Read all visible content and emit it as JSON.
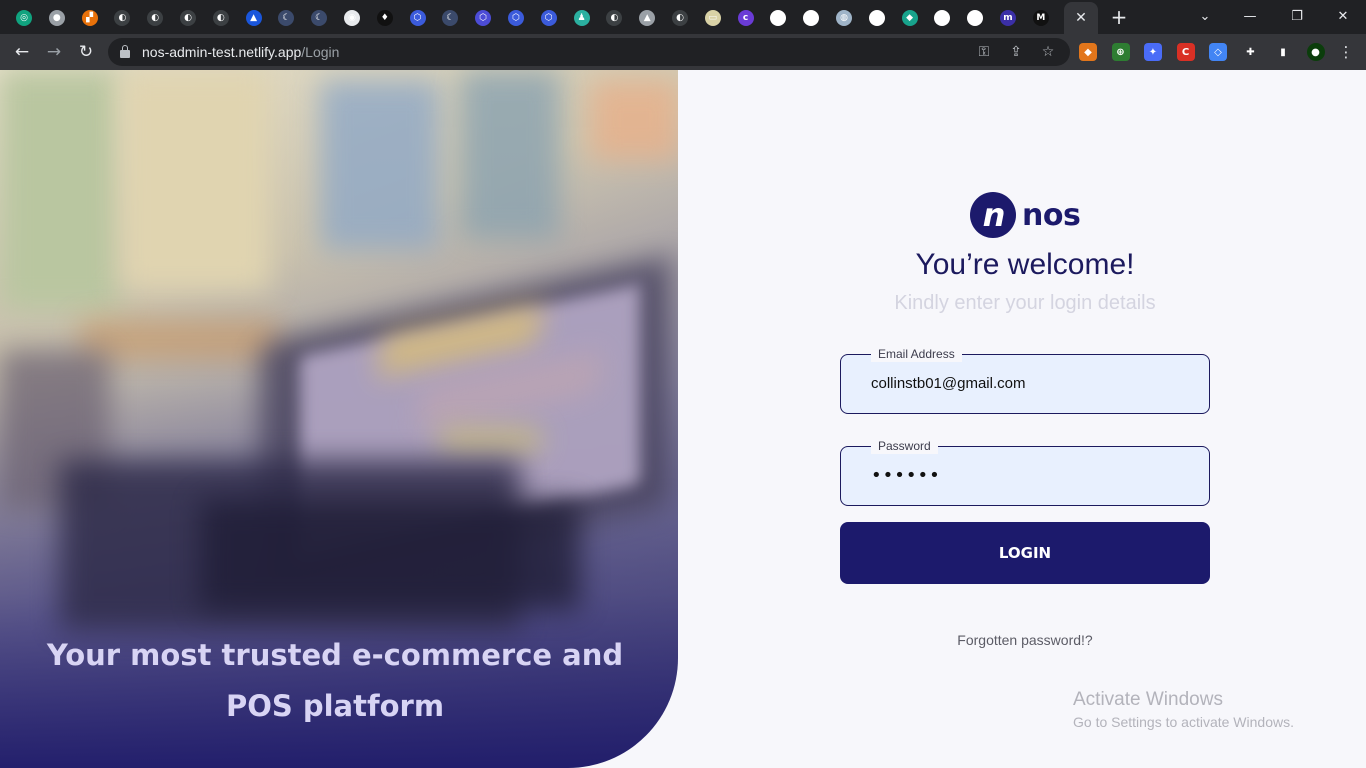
{
  "browser": {
    "tabs": [
      {
        "icon": "openai-icon",
        "color": "#10a37f",
        "glyph": "◎"
      },
      {
        "icon": "globe-icon",
        "color": "#9aa0a6",
        "glyph": "●"
      },
      {
        "icon": "grid-logo-icon",
        "color": "#e8710a",
        "glyph": "▞"
      },
      {
        "icon": "github-icon",
        "color": "#3c4043",
        "glyph": "◐"
      },
      {
        "icon": "github-icon",
        "color": "#3c4043",
        "glyph": "◐"
      },
      {
        "icon": "github-icon",
        "color": "#3c4043",
        "glyph": "◐"
      },
      {
        "icon": "github-icon",
        "color": "#3c4043",
        "glyph": "◐"
      },
      {
        "icon": "triangle-logo-icon",
        "color": "#1a56db",
        "glyph": "▲"
      },
      {
        "icon": "moon-icon",
        "color": "#3b4a6b",
        "glyph": "☾"
      },
      {
        "icon": "moon-icon",
        "color": "#3b4a6b",
        "glyph": "☾"
      },
      {
        "icon": "chrome-icon",
        "color": "#e8eaed",
        "glyph": "◉"
      },
      {
        "icon": "ethereum-icon",
        "color": "#111111",
        "glyph": "♦"
      },
      {
        "icon": "hexagon-icon",
        "color": "#3b5bdb",
        "glyph": "⬡"
      },
      {
        "icon": "moon-icon",
        "color": "#3b4a6b",
        "glyph": "☾"
      },
      {
        "icon": "hexagon-icon",
        "color": "#4c4cd6",
        "glyph": "⬡"
      },
      {
        "icon": "hexagon-icon",
        "color": "#3b5bdb",
        "glyph": "⬡"
      },
      {
        "icon": "hexagon-icon",
        "color": "#3b5bdb",
        "glyph": "⬡"
      },
      {
        "icon": "person-icon",
        "color": "#2bb0a0",
        "glyph": "♟"
      },
      {
        "icon": "github-icon",
        "color": "#3c4043",
        "glyph": "◐"
      },
      {
        "icon": "sail-icon",
        "color": "#9aa0a6",
        "glyph": "▲"
      },
      {
        "icon": "github-icon",
        "color": "#3c4043",
        "glyph": "◐"
      },
      {
        "icon": "card-icon",
        "color": "#d9d2a6",
        "glyph": "▭"
      },
      {
        "icon": "colorlib-icon",
        "color": "#6a3bd6",
        "glyph": "c"
      },
      {
        "icon": "globe-icon",
        "color": "#ffffff",
        "glyph": "◒"
      },
      {
        "icon": "globe-icon",
        "color": "#ffffff",
        "glyph": "◒"
      },
      {
        "icon": "elephant-icon",
        "color": "#9fb4c8",
        "glyph": "◍"
      },
      {
        "icon": "globe-icon",
        "color": "#ffffff",
        "glyph": "◒"
      },
      {
        "icon": "diamond-logo-icon",
        "color": "#18a38c",
        "glyph": "◆"
      },
      {
        "icon": "globe-icon",
        "color": "#ffffff",
        "glyph": "◒"
      },
      {
        "icon": "globe-icon",
        "color": "#ffffff",
        "glyph": "◒"
      },
      {
        "icon": "m-logo-icon",
        "color": "#3b2fa6",
        "glyph": "m"
      },
      {
        "icon": "m-logo-icon",
        "color": "#111111",
        "glyph": "M"
      }
    ],
    "active_tab_close": "✕",
    "new_tab": "+",
    "url_host": "nos-admin-test.netlify.app",
    "url_path": "/Login",
    "extensions": [
      {
        "icon": "metamask-icon",
        "color": "#e2761b",
        "glyph": "◆"
      },
      {
        "icon": "green-circle-icon",
        "color": "#2e7d32",
        "glyph": "⊕"
      },
      {
        "icon": "satellite-icon",
        "color": "#4a6cf7",
        "glyph": "✦"
      },
      {
        "icon": "red-shield-icon",
        "color": "#d93025",
        "glyph": "C"
      },
      {
        "icon": "drop-icon",
        "color": "#4285f4",
        "glyph": "◇"
      },
      {
        "icon": "puzzle-icon",
        "color": "#35363a",
        "glyph": "✚"
      },
      {
        "icon": "sidepanel-icon",
        "color": "#35363a",
        "glyph": "▮"
      },
      {
        "icon": "avatar-icon",
        "color": "#0b3d0b",
        "glyph": "●"
      }
    ]
  },
  "hero": {
    "tagline": "Your most trusted e-commerce and POS platform"
  },
  "login": {
    "logo_text": "nos",
    "logo_letter": "n",
    "title": "You’re welcome!",
    "subtitle": "Kindly enter your login details",
    "email_label": "Email Address",
    "email_value": "collinstb01@gmail.com",
    "password_label": "Password",
    "password_value": "••••••",
    "button_label": "LOGIN",
    "forgot_label": "Forgotten password!?"
  },
  "watermark": {
    "line1": "Activate Windows",
    "line2": "Go to Settings to activate Windows."
  }
}
